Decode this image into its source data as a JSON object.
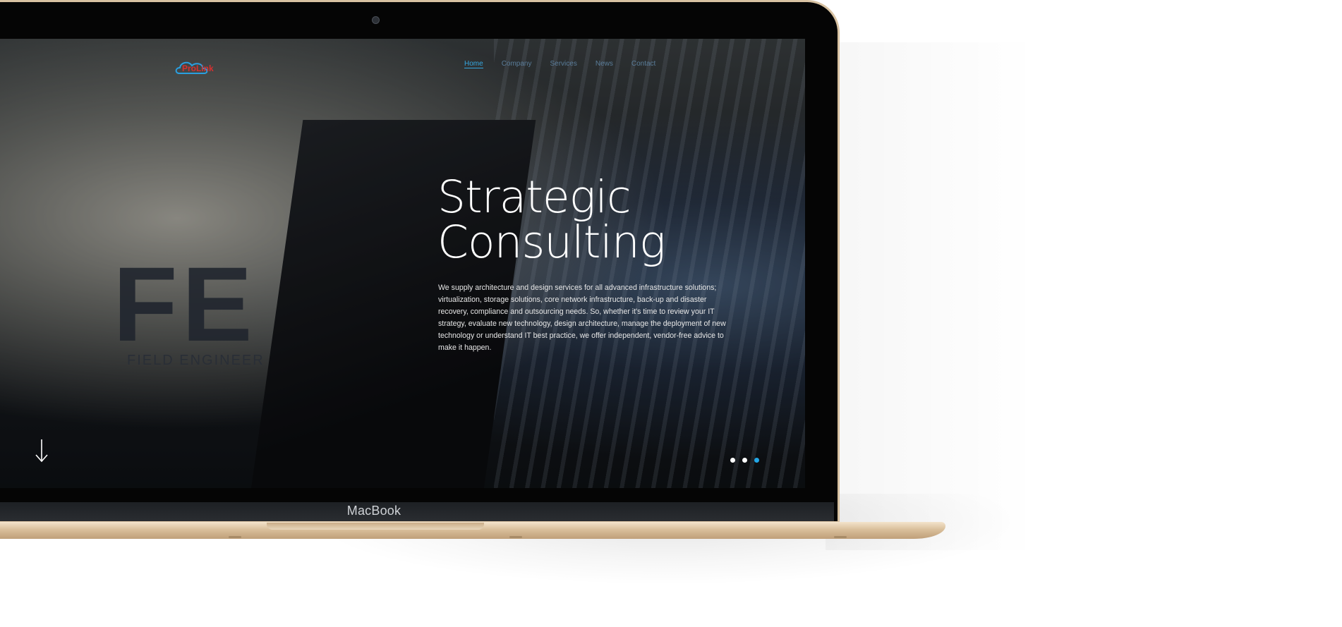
{
  "site": {
    "logo_text": "ProLink",
    "nav": [
      {
        "label": "Home",
        "active": true
      },
      {
        "label": "Company",
        "active": false
      },
      {
        "label": "Services",
        "active": false
      },
      {
        "label": "News",
        "active": false
      },
      {
        "label": "Contact",
        "active": false
      }
    ],
    "hero": {
      "title_line1": "Strategic",
      "title_line2": "Consulting",
      "body": "We supply architecture and design services for all advanced infrastructure solutions; virtualization, storage solutions, core network infrastructure, back-up and disaster recovery, compliance and outsourcing needs. So, whether it's time to review your IT strategy, evaluate new technology, design architecture, manage the deployment of new technology or understand IT best practice, we offer independent, vendor-free advice to make it happen."
    },
    "shirt_text": {
      "letters": "FE",
      "caption": "FIELD ENGINEER"
    },
    "slider": {
      "slide_count": 3,
      "active_index": 3
    }
  },
  "device": {
    "label": "MacBook"
  },
  "colors": {
    "accent": "#22a6e6",
    "logo_red": "#d83030",
    "frame_gold": "#d8c2a2"
  }
}
